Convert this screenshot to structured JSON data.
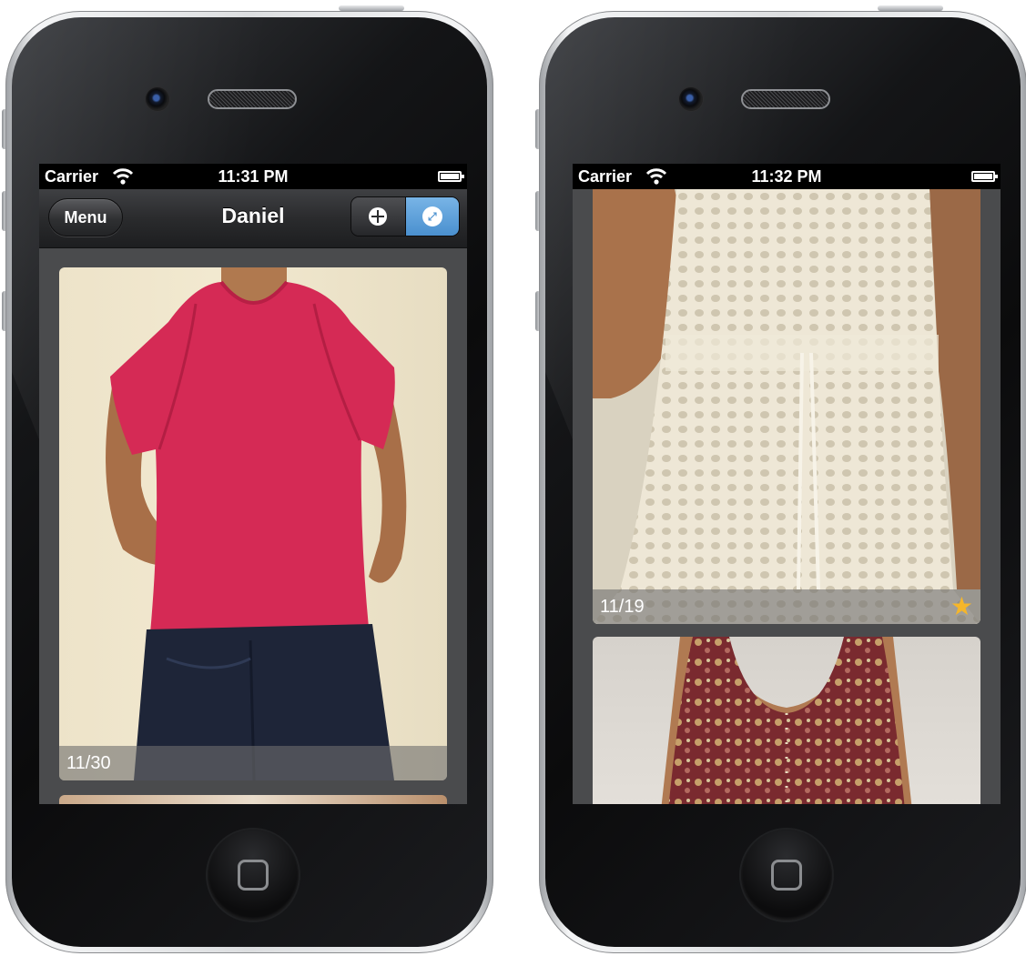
{
  "left_phone": {
    "status": {
      "carrier": "Carrier",
      "time": "11:31 PM"
    },
    "navbar": {
      "menu_label": "Menu",
      "title": "Daniel"
    },
    "segmented": {
      "grid_icon": "grid-icon",
      "expand_icon": "expand-icon",
      "selected": "expand"
    },
    "cards": [
      {
        "caption": "11/30"
      }
    ]
  },
  "right_phone": {
    "status": {
      "carrier": "Carrier",
      "time": "11:32 PM"
    },
    "cards": [
      {
        "caption": "11/19",
        "favorite_icon": "star-icon"
      }
    ]
  },
  "colors": {
    "accent_blue": "#4a90cf",
    "star_gold": "#f5b62a",
    "screen_bg": "#4a4b4d"
  }
}
